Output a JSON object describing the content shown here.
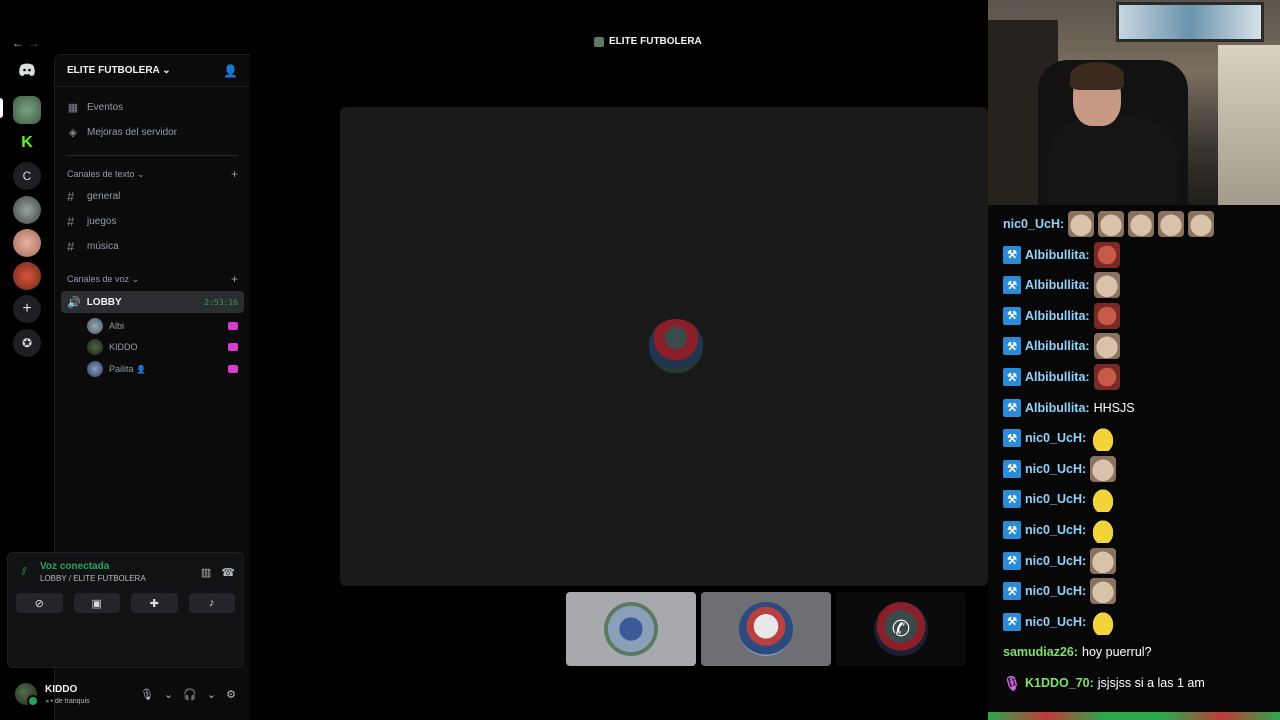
{
  "window": {
    "title": "ELITE FUTBOLERA"
  },
  "server": {
    "name": "ELITE FUTBOLERA"
  },
  "sidebar": {
    "top_items": [
      {
        "label": "Eventos",
        "icon": "calendar-icon"
      },
      {
        "label": "Mejoras del servidor",
        "icon": "boost-icon"
      }
    ],
    "text_category": "Canales de texto",
    "text_channels": [
      "general",
      "juegos",
      "música"
    ],
    "voice_category": "Canales de voz",
    "voice_channel": {
      "name": "LOBBY",
      "timer": "2:53:16"
    },
    "members": [
      {
        "name": "Albi"
      },
      {
        "name": "KIDDO"
      },
      {
        "name": "Pailita"
      }
    ]
  },
  "rail": {
    "letter_server": "C"
  },
  "voice_panel": {
    "status": "Voz conectada",
    "location": "LOBBY / ELITE FUTBOLERA"
  },
  "user": {
    "name": "KIDDO",
    "status": "de tranquis"
  },
  "chat": {
    "lines": [
      {
        "user": "nic0_UcH",
        "color": "#8fd3ff",
        "badge": false,
        "emotes": [
          "cat",
          "cat",
          "cat",
          "cat",
          "cat"
        ],
        "text": ""
      },
      {
        "user": "Albibullita",
        "color": "#8fd3ff",
        "badge": true,
        "emotes": [
          "red"
        ],
        "text": ""
      },
      {
        "user": "Albibullita",
        "color": "#8fd3ff",
        "badge": true,
        "emotes": [
          "cat"
        ],
        "text": ""
      },
      {
        "user": "Albibullita",
        "color": "#8fd3ff",
        "badge": true,
        "emotes": [
          "red"
        ],
        "text": ""
      },
      {
        "user": "Albibullita",
        "color": "#8fd3ff",
        "badge": true,
        "emotes": [
          "cat"
        ],
        "text": ""
      },
      {
        "user": "Albibullita",
        "color": "#8fd3ff",
        "badge": true,
        "emotes": [
          "red"
        ],
        "text": ""
      },
      {
        "user": "Albibullita",
        "color": "#8fd3ff",
        "badge": true,
        "emotes": [],
        "text": "HHSJS"
      },
      {
        "user": "nic0_UcH",
        "color": "#8fd3ff",
        "badge": true,
        "emotes": [
          "blob"
        ],
        "text": ""
      },
      {
        "user": "nic0_UcH",
        "color": "#8fd3ff",
        "badge": true,
        "emotes": [
          "cat"
        ],
        "text": ""
      },
      {
        "user": "nic0_UcH",
        "color": "#8fd3ff",
        "badge": true,
        "emotes": [
          "blob"
        ],
        "text": ""
      },
      {
        "user": "nic0_UcH",
        "color": "#8fd3ff",
        "badge": true,
        "emotes": [
          "blob"
        ],
        "text": ""
      },
      {
        "user": "nic0_UcH",
        "color": "#8fd3ff",
        "badge": true,
        "emotes": [
          "cat"
        ],
        "text": ""
      },
      {
        "user": "nic0_UcH",
        "color": "#8fd3ff",
        "badge": true,
        "emotes": [
          "cat"
        ],
        "text": ""
      },
      {
        "user": "nic0_UcH",
        "color": "#8fd3ff",
        "badge": true,
        "emotes": [
          "blob"
        ],
        "text": ""
      },
      {
        "user": "samudiaz26",
        "color": "#7fe06a",
        "badge": false,
        "emotes": [],
        "text": "hoy puerrul?"
      },
      {
        "user": "K1DDO_70",
        "color": "#7fe06a",
        "badge": "mic",
        "emotes": [],
        "text": "jsjsjss si a las 1 am"
      }
    ]
  }
}
